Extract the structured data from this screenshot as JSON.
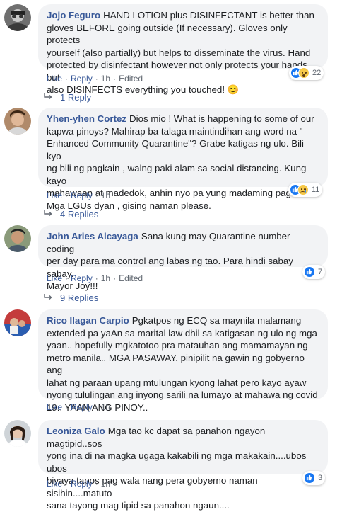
{
  "colors": {
    "author": "#385898",
    "bubble": "#f2f3f5",
    "meta": "#606770",
    "like": "#1877f2"
  },
  "comments": [
    {
      "author": "Jojo Feguro",
      "lines": [
        "HAND LOTION plus DISINFECTANT is better than",
        "gloves BEFORE going outside (If necessary). Gloves only protects",
        "yourself (also partially) but helps to disseminate the virus. Hand",
        "protected by disinfectant however not only protects your hands but",
        "also DISINFECTS everything you touched! 😊"
      ],
      "reactions": {
        "icons": [
          "like-icon",
          "wow-icon"
        ],
        "count": "22"
      },
      "actions": {
        "like": "Like",
        "reply": "Reply",
        "time": "1h",
        "edited": "Edited"
      },
      "replies": "1 Reply"
    },
    {
      "author": "Yhen-yhen Cortez",
      "lines": [
        "Dios mio ! What is happening to some of our",
        "kapwa pinoys? Mahirap ba talaga maintindihan ang word na \"",
        "Enhanced Community Quarantine\"? Grabe katigas ng ulo. Bili kyo",
        "ng bili ng pagkain , walng paki alam sa social distancing. Kung kayo",
        "mahawaan at madedok, anhin nyo pa yung madaming pagkain ?",
        "Mga LGUs dyan , gising naman please."
      ],
      "reactions": {
        "icons": [
          "like-icon",
          "sad-icon"
        ],
        "count": "11"
      },
      "actions": {
        "like": "Like",
        "reply": "Reply",
        "time": "1h"
      },
      "replies": "4 Replies"
    },
    {
      "author": "John Aries Alcayaga",
      "lines": [
        "Sana kung may Quarantine number coding",
        "per day para ma control ang labas ng tao. Para hindi sabay sabay.",
        "Mayor Joy!!!"
      ],
      "reactions": {
        "icons": [
          "like-icon"
        ],
        "count": "7"
      },
      "actions": {
        "like": "Like",
        "reply": "Reply",
        "time": "1h",
        "edited": "Edited"
      },
      "replies": "9 Replies"
    },
    {
      "author": "Rico Ilagan Carpio",
      "lines": [
        "Pgkatpos ng ECQ sa maynila malamang",
        "extended pa yaAn sa marital law dhil sa katigasan ng ulo ng mga",
        "yaan.. hopefully mgkatotoo pra matauhan ang mamamayan ng",
        "metro manila.. MGA PASAWAY. pinipilit na gawin ng gobyerno ang",
        "lahat ng paraan upang mtulungan kyong lahat pero kayo ayaw",
        "nyong tululingan ang inyong sarili na lumayo at mahawa ng covid",
        "19.. YAAN ANG PINOY.."
      ],
      "actions": {
        "like": "Like",
        "reply": "Reply",
        "time": "1h"
      }
    },
    {
      "author": "Leoniza Galo",
      "lines": [
        "Mga tao kc dapat sa panahon ngayon magtipid..sos",
        "yong ina di na magka ugaga kakabili ng mga makakain....ubos ubos",
        "biyaya tapos pag wala nang pera gobyerno naman sisihin....matuto",
        "sana tayong mag tipid sa panahon ngaun...."
      ],
      "reactions": {
        "icons": [
          "like-icon"
        ],
        "count": "3"
      },
      "actions": {
        "like": "Like",
        "reply": "Reply",
        "time": "1h"
      }
    }
  ]
}
